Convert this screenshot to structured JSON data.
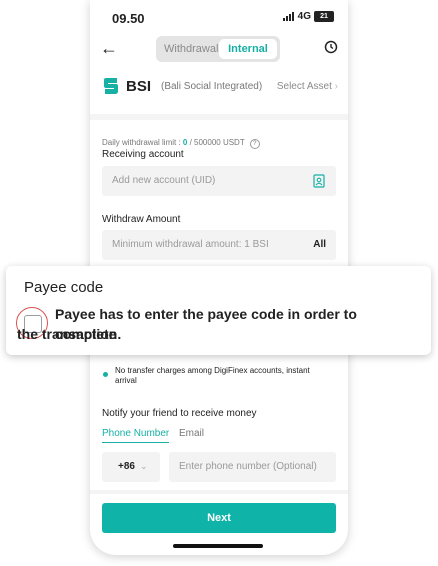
{
  "status_bar": {
    "time": "09.50",
    "network": "4G",
    "battery": "21"
  },
  "nav": {
    "tab_withdrawal": "Withdrawal",
    "tab_internal": "Internal"
  },
  "asset": {
    "symbol": "BSI",
    "full_name": "(Bali Social Integrated)",
    "select_label": "Select Asset"
  },
  "limit": {
    "prefix": "Daily withdrawal limit : ",
    "used": "0",
    "suffix": " / 500000 USDT"
  },
  "receiving": {
    "label": "Receiving account",
    "placeholder": "Add new account (UID)"
  },
  "amount": {
    "label": "Withdraw Amount",
    "placeholder": "Minimum withdrawal amount: 1 BSI",
    "all_label": "All"
  },
  "callout": {
    "title": "Payee code",
    "text_line1": "Payee has to enter the payee code in order to complete",
    "text_line2": "the transaction.",
    "checked": false
  },
  "fees": {
    "text": "No transfer charges among DigiFinex accounts, instant arrival"
  },
  "notify": {
    "label": "Notify your friend to receive money",
    "tab_phone": "Phone Number",
    "tab_email": "Email",
    "country_code": "+86",
    "phone_placeholder": "Enter phone number (Optional)"
  },
  "next_label": "Next",
  "colors": {
    "accent": "#16b0a4",
    "button": "#0fb3a8",
    "highlight_ring": "#d9534f"
  }
}
